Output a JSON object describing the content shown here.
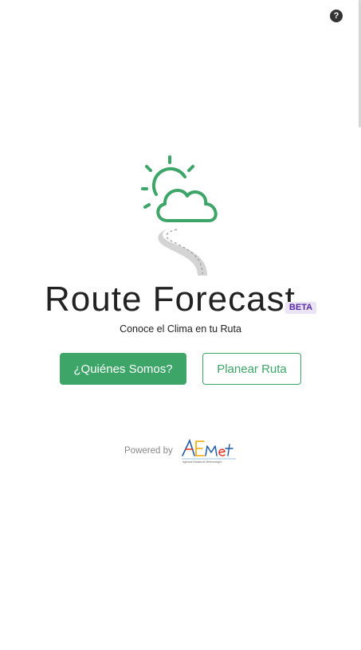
{
  "header": {
    "help_glyph": "?",
    "help_icon": "question-circle-icon"
  },
  "hero": {
    "illustration_icon": "sun-cloud-road-icon",
    "title": "Route Forecast",
    "badge": "BETA",
    "subtitle": "Conoce el Clima en tu Ruta"
  },
  "actions": {
    "about_label": "¿Quiénes Somos?",
    "plan_label": "Planear Ruta"
  },
  "footer": {
    "powered_label": "Powered by",
    "logo_text": "AEMet",
    "logo_caption": "Agencia Estatal de Meteorología"
  },
  "colors": {
    "accent_green": "#3da567",
    "badge_bg": "#ebe3f6",
    "badge_text": "#5a2ca0",
    "title_text": "#222222"
  }
}
